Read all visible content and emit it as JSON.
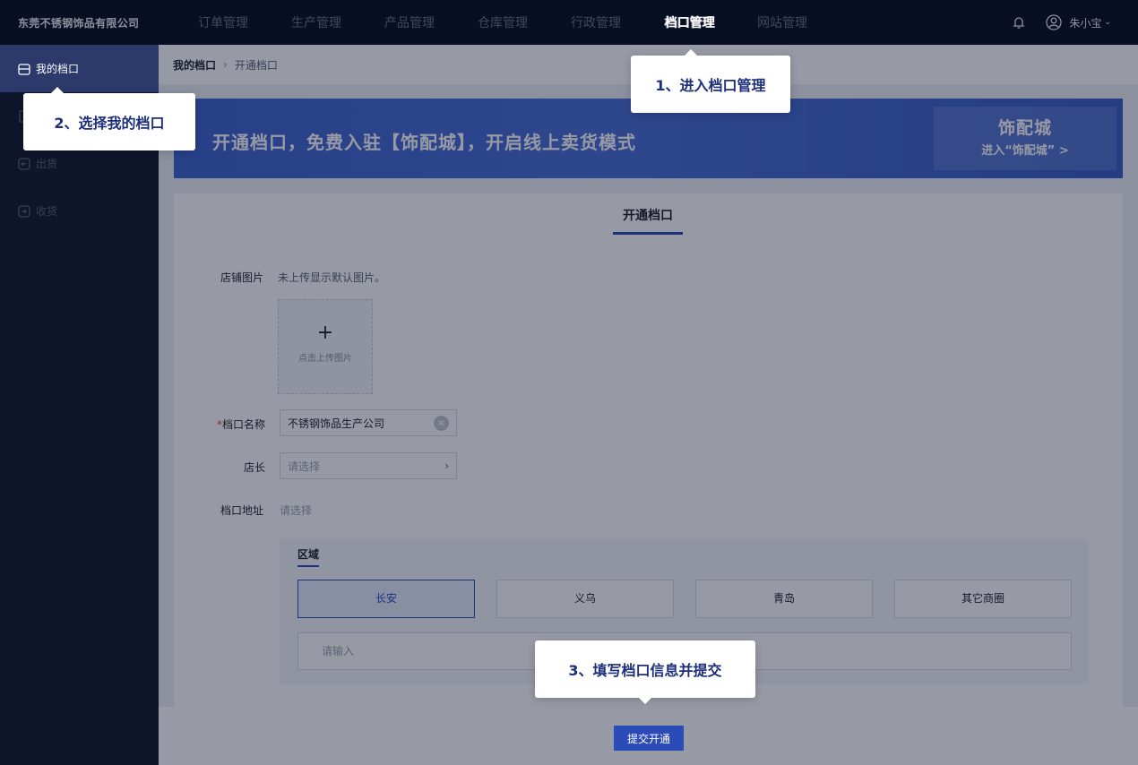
{
  "header": {
    "company": "东莞不锈钢饰品有限公司",
    "nav": [
      "订单管理",
      "生产管理",
      "产品管理",
      "仓库管理",
      "行政管理",
      "档口管理",
      "网站管理"
    ],
    "active_nav": "档口管理",
    "user_name": "朱小宝"
  },
  "sidebar": {
    "items": [
      {
        "label": "我的档口"
      },
      {
        "label": ""
      },
      {
        "label": "出货"
      },
      {
        "label": "收货"
      }
    ]
  },
  "breadcrumb": {
    "root": "我的档口",
    "current": "开通档口"
  },
  "banner": {
    "text": "开通档口，免费入驻【饰配城】，开启线上卖货模式",
    "logo": "饰配城",
    "link": "进入“饰配城” >"
  },
  "form": {
    "tab": "开通档口",
    "image_label": "店铺图片",
    "image_hint": "未上传显示默认图片。",
    "upload_plus": "+",
    "upload_text": "点击上传图片",
    "name_label": "档口名称",
    "name_value": "不锈钢饰品生产公司",
    "manager_label": "店长",
    "manager_placeholder": "请选择",
    "address_label": "档口地址",
    "address_hint": "请选择",
    "region_title": "区域",
    "region_options": [
      "长安",
      "义乌",
      "青岛",
      "其它商圈"
    ],
    "region_selected": "长安",
    "region_input_placeholder": "请输入",
    "submit": "提交开通"
  },
  "callouts": {
    "step1": "1、进入档口管理",
    "step2": "2、选择我的档口",
    "step3": "3、填写档口信息并提交"
  },
  "colors": {
    "accent": "#2b4bb8",
    "topbar": "#0c1120",
    "sidebar": "#151b2c",
    "banner": "#4b6fd6",
    "required": "#e53e3e"
  },
  "icons": [
    "bell-icon",
    "user-icon",
    "store-icon",
    "doc-icon",
    "ship-out-icon",
    "receive-icon",
    "close-circle-icon",
    "chevron-right-icon"
  ]
}
